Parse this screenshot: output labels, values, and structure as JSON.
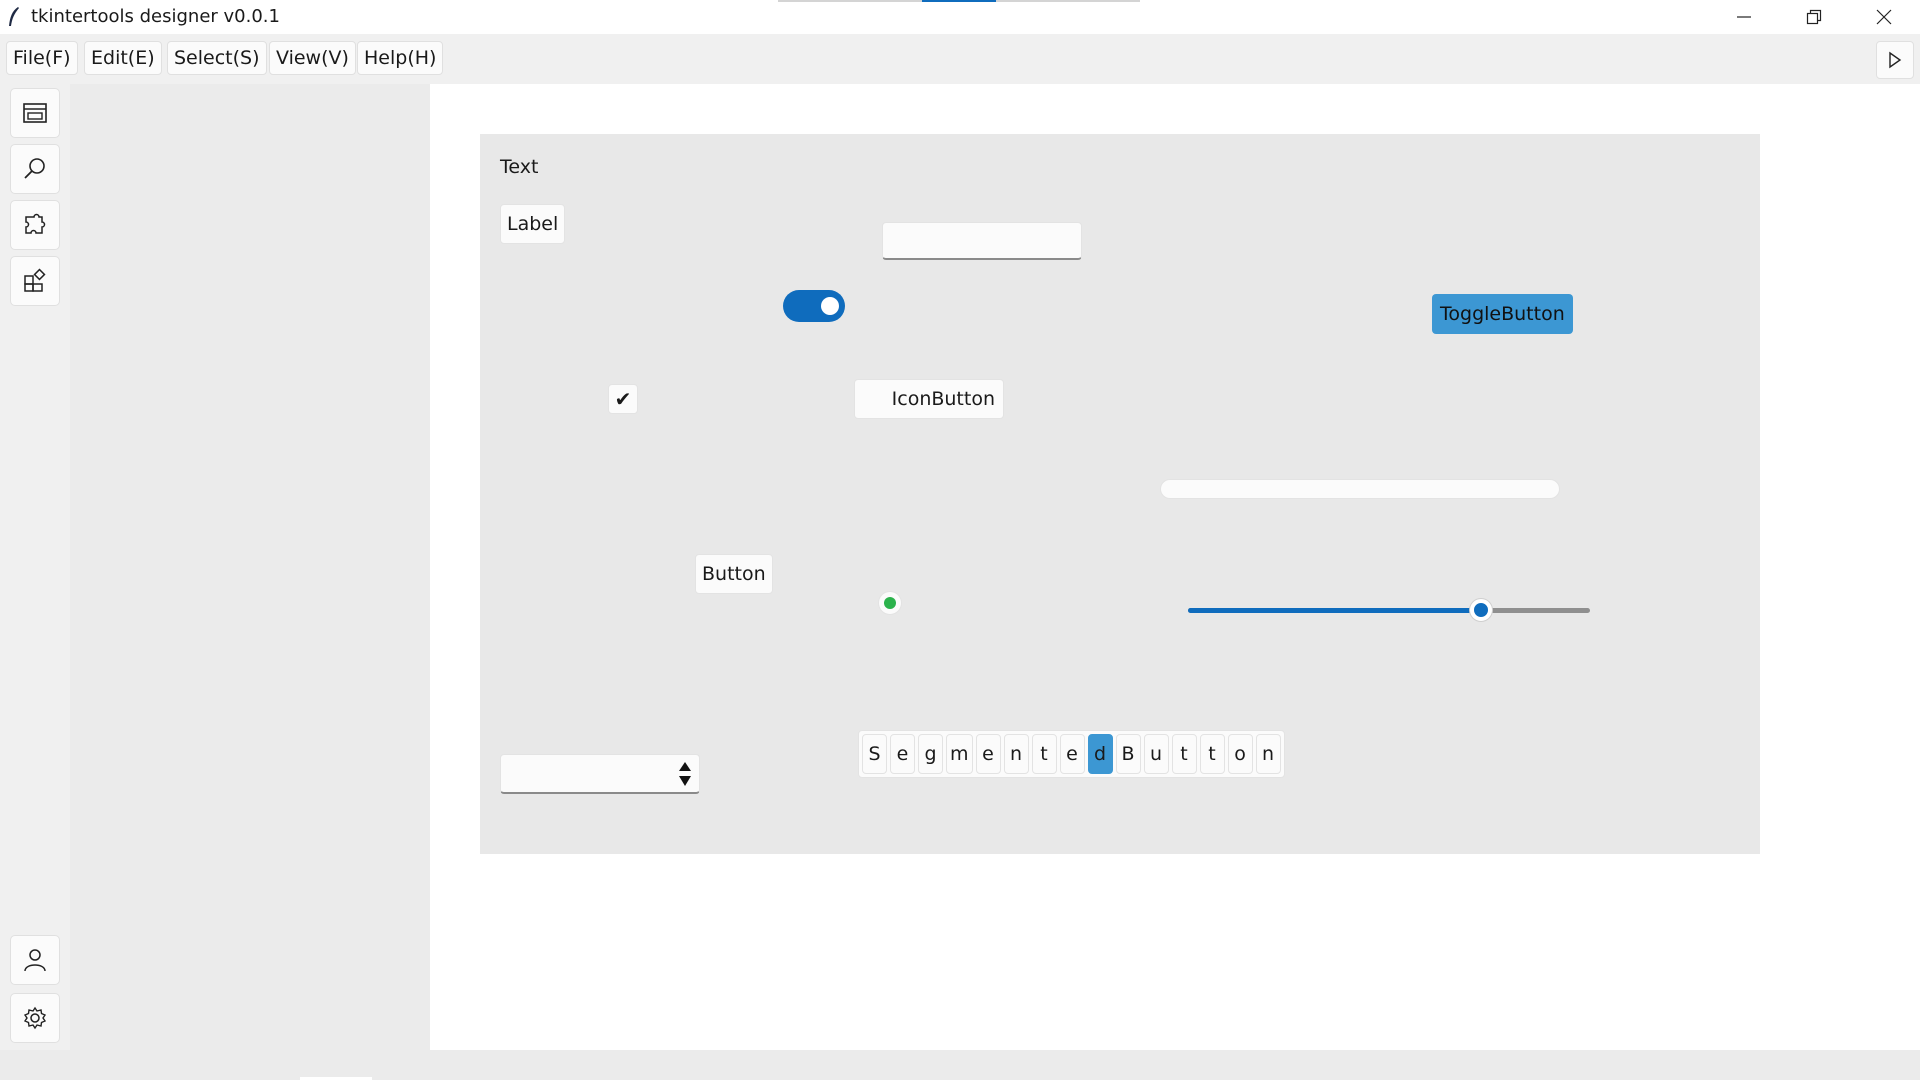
{
  "window": {
    "title": "tkintertools designer v0.0.1",
    "accent": "#0f6cbd"
  },
  "menu": {
    "items": [
      {
        "label": "File(F)"
      },
      {
        "label": "Edit(E)"
      },
      {
        "label": "Select(S)"
      },
      {
        "label": "View(V)"
      },
      {
        "label": "Help(H)"
      }
    ],
    "run_icon": "play-icon"
  },
  "sidebar": {
    "top_icons": [
      "window-icon",
      "search-icon",
      "puzzle-icon",
      "widgets-icon"
    ],
    "bottom_icons": [
      "user-icon",
      "gear-icon"
    ]
  },
  "canvas": {
    "text": "Text",
    "label": "Label",
    "entry_value": "",
    "switch_on": true,
    "toggle_button": "ToggleButton",
    "toggle_color": "#3c97d3",
    "checkbox_mark": "✔",
    "icon_button": "IconButton",
    "progress": 0,
    "button": "Button",
    "radio_color": "#2bb24c",
    "scale_fraction": 0.73,
    "spinbox_value": "",
    "segmented": {
      "segments": [
        "S",
        "e",
        "g",
        "m",
        "e",
        "n",
        "t",
        "e",
        "d",
        "B",
        "u",
        "t",
        "t",
        "o",
        "n"
      ],
      "selected_index": 8
    }
  }
}
